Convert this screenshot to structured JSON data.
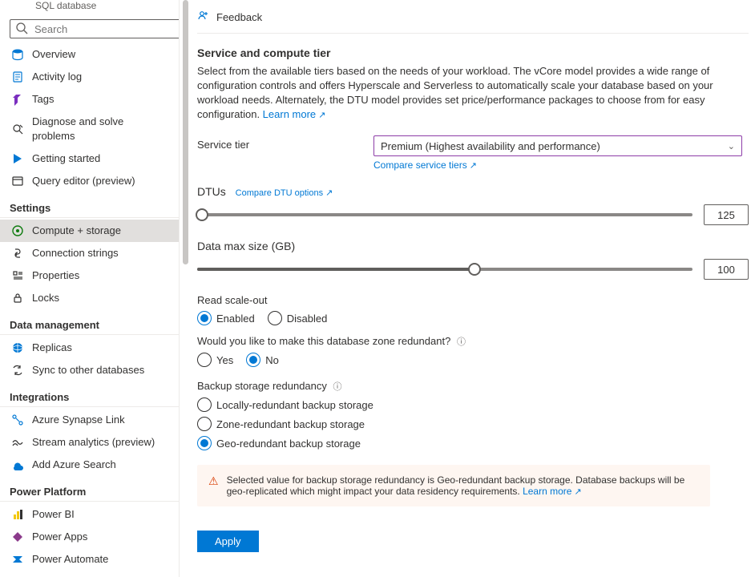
{
  "svc_subtitle": "SQL database",
  "search_placeholder": "Search",
  "sidebar": {
    "items_top": [
      {
        "label": "Overview"
      },
      {
        "label": "Activity log"
      },
      {
        "label": "Tags"
      },
      {
        "label": "Diagnose and solve problems"
      },
      {
        "label": "Getting started"
      },
      {
        "label": "Query editor (preview)"
      }
    ],
    "sections": [
      {
        "title": "Settings",
        "items": [
          {
            "label": "Compute + storage",
            "selected": true
          },
          {
            "label": "Connection strings"
          },
          {
            "label": "Properties"
          },
          {
            "label": "Locks"
          }
        ]
      },
      {
        "title": "Data management",
        "items": [
          {
            "label": "Replicas"
          },
          {
            "label": "Sync to other databases"
          }
        ]
      },
      {
        "title": "Integrations",
        "items": [
          {
            "label": "Azure Synapse Link"
          },
          {
            "label": "Stream analytics (preview)"
          },
          {
            "label": "Add Azure Search"
          }
        ]
      },
      {
        "title": "Power Platform",
        "items": [
          {
            "label": "Power BI"
          },
          {
            "label": "Power Apps"
          },
          {
            "label": "Power Automate"
          }
        ]
      }
    ]
  },
  "toolbar": {
    "feedback": "Feedback"
  },
  "content": {
    "title": "Service and compute tier",
    "desc": "Select from the available tiers based on the needs of your workload. The vCore model provides a wide range of configuration controls and offers Hyperscale and Serverless to automatically scale your database based on your workload needs. Alternately, the DTU model provides set price/performance packages to choose from for easy configuration. ",
    "learn_more": "Learn more",
    "service_tier_label": "Service tier",
    "service_tier_value": "Premium (Highest availability and performance)",
    "compare_tiers": "Compare service tiers",
    "dtus_label": "DTUs",
    "compare_dtu": "Compare DTU options",
    "dtus_value": "125",
    "data_max_label": "Data max size (GB)",
    "data_max_value": "100",
    "read_scale_label": "Read scale-out",
    "enabled": "Enabled",
    "disabled": "Disabled",
    "zone_q": "Would you like to make this database zone redundant?",
    "yes": "Yes",
    "no": "No",
    "backup_label": "Backup storage redundancy",
    "backup_opts": [
      "Locally-redundant backup storage",
      "Zone-redundant backup storage",
      "Geo-redundant backup storage"
    ],
    "warning_text": "Selected value for backup storage redundancy is Geo-redundant backup storage. Database backups will be geo-replicated which might impact your data residency requirements. ",
    "warning_link": "Learn more",
    "apply": "Apply"
  }
}
